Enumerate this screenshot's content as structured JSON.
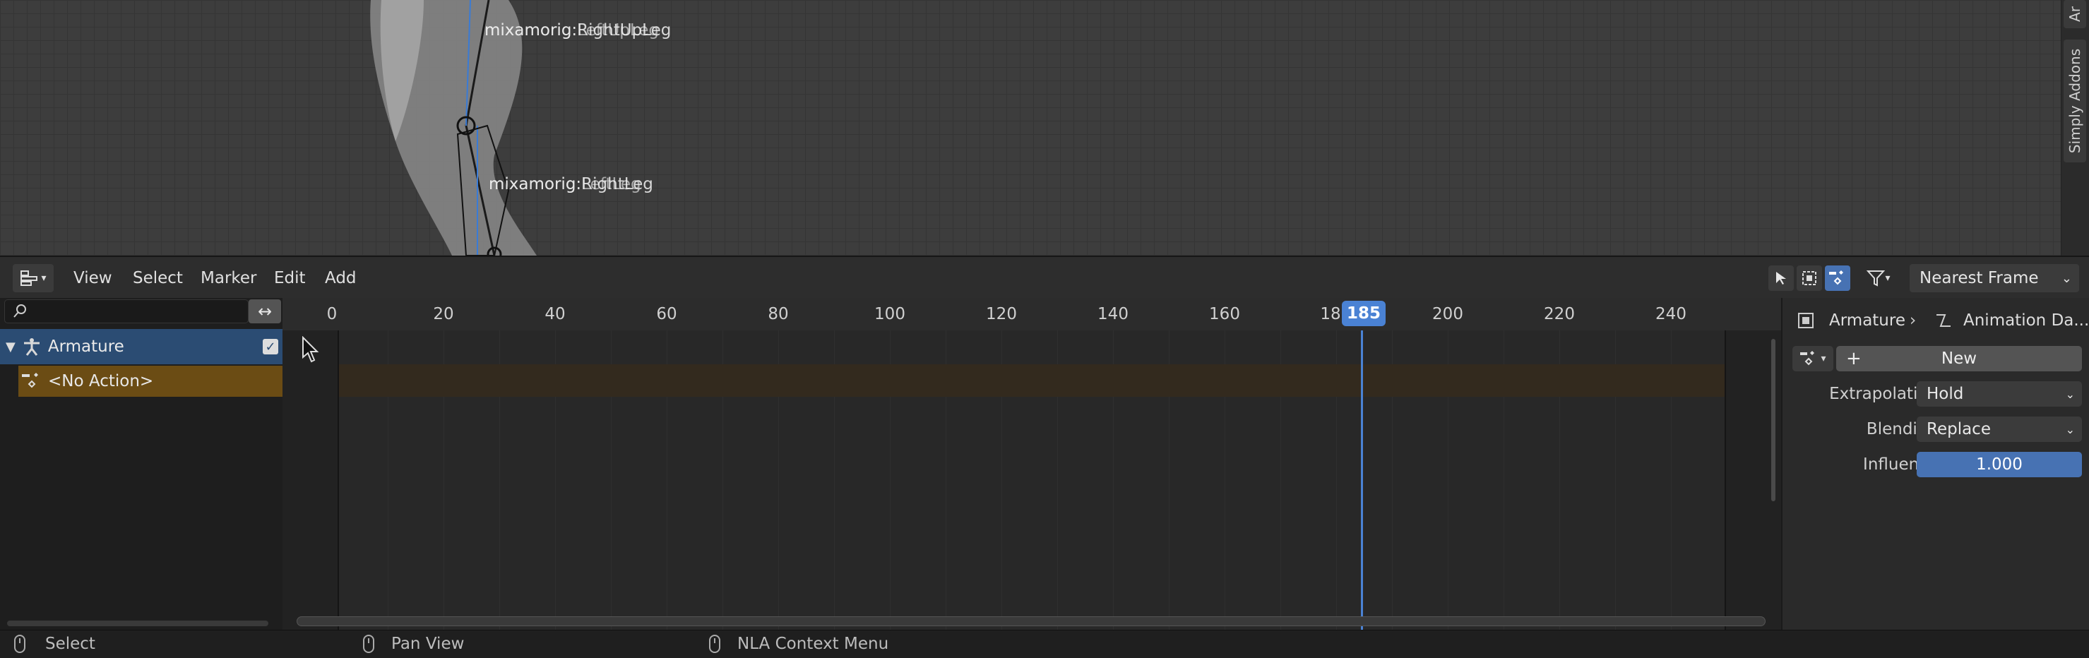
{
  "viewport": {
    "bone_labels": [
      {
        "text": "mixamorig:RightUpLeg"
      },
      {
        "text": "mixamorig:LeftUpLeg"
      },
      {
        "text": "mixamorig:RightLeg"
      },
      {
        "text": "mixamorig:LeftLeg"
      }
    ],
    "sidebar_tabs": [
      "Simply Addons",
      "Ar"
    ]
  },
  "header": {
    "menus": [
      "View",
      "Select",
      "Marker",
      "Edit",
      "Add"
    ],
    "snap": "Nearest Frame"
  },
  "channels": {
    "armature_label": "Armature",
    "action_label": "<No Action>"
  },
  "ruler": {
    "ticks": [
      "0",
      "20",
      "40",
      "60",
      "80",
      "100",
      "120",
      "140",
      "160",
      "18",
      "200",
      "220",
      "240"
    ],
    "current_frame": "185"
  },
  "sidebar": {
    "breadcrumb_object": "Armature",
    "breadcrumb_data": "Animation Da...",
    "new_label": "New",
    "extrapolation_label": "Extrapolation",
    "extrapolation_value": "Hold",
    "blending_label": "Blending",
    "blending_value": "Replace",
    "influence_label": "Influence",
    "influence_value": "1.000"
  },
  "status": {
    "left": "Select",
    "middle": "Pan View",
    "right": "NLA Context Menu"
  },
  "colors": {
    "accent": "#4772b3",
    "playhead": "#4a82d4",
    "action_row": "#6b4c14",
    "armature_row": "#2b4c73"
  }
}
